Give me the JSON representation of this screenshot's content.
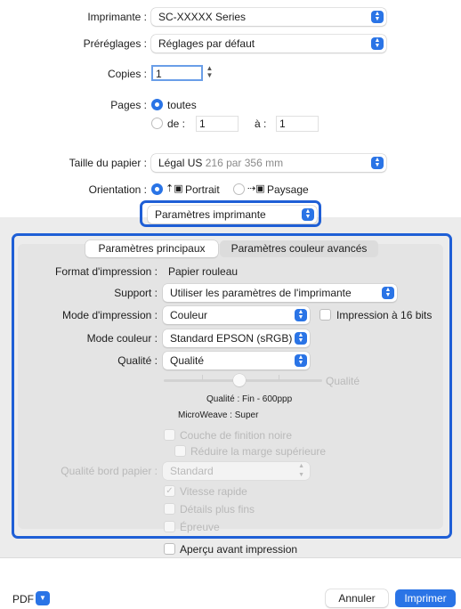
{
  "printer": {
    "label": "Imprimante :",
    "value": "SC-XXXXX Series"
  },
  "presets": {
    "label": "Préréglages :",
    "value": "Réglages par défaut"
  },
  "copies": {
    "label": "Copies :",
    "value": "1"
  },
  "pages": {
    "label": "Pages :",
    "all_label": "toutes",
    "from_label": "de :",
    "from_value": "1",
    "to_label": "à :",
    "to_value": "1"
  },
  "paper_size": {
    "label": "Taille du papier :",
    "value": "Légal US",
    "dimensions": "216 par 356 mm"
  },
  "orientation": {
    "label": "Orientation :",
    "portrait": "Portrait",
    "landscape": "Paysage"
  },
  "section_popup": {
    "value": "Paramètres imprimante"
  },
  "tabs": {
    "main": "Paramètres principaux",
    "advanced": "Paramètres couleur avancés"
  },
  "settings": {
    "print_format_label": "Format d'impression :",
    "print_format_value": "Papier rouleau",
    "support_label": "Support :",
    "support_value": "Utiliser les paramètres de l'imprimante",
    "print_mode_label": "Mode d'impression :",
    "print_mode_value": "Couleur",
    "bits16_label": "Impression à 16 bits",
    "color_mode_label": "Mode couleur :",
    "color_mode_value": "Standard EPSON (sRGB)",
    "quality_label": "Qualité :",
    "quality_value": "Qualité",
    "slider_end_label": "Qualité",
    "quality_info": "Qualité : Fin - 600ppp",
    "microweave_info": "MicroWeave : Super",
    "black_finish": "Couche de finition noire",
    "reduce_margin": "Réduire la marge supérieure",
    "edge_quality_label": "Qualité bord papier :",
    "edge_quality_value": "Standard",
    "fast_speed": "Vitesse rapide",
    "finer_detail": "Détails plus fins",
    "proof": "Épreuve"
  },
  "preview_label": "Aperçu avant impression",
  "footer": {
    "pdf": "PDF",
    "cancel": "Annuler",
    "print": "Imprimer"
  },
  "colors": {
    "accent": "#2a74e6",
    "highlight": "#1f5fd6"
  }
}
